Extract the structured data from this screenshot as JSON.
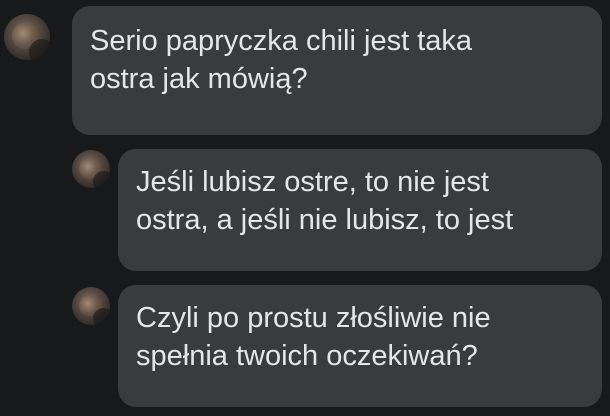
{
  "comments": [
    {
      "avatar_icon": "user-avatar-icon",
      "text": "Serio papryczka chili jest taka\nostra jak mówią?"
    },
    {
      "avatar_icon": "user-avatar-icon",
      "text": "Jeśli lubisz ostre, to nie jest\nostra, a jeśli nie lubisz, to jest"
    },
    {
      "avatar_icon": "user-avatar-icon",
      "text": "Czyli po prostu złośliwie nie\nspełnia twoich oczekiwań?"
    }
  ],
  "colors": {
    "background": "#18191a",
    "bubble": "#3a3b3c",
    "text": "#e4e6eb"
  }
}
